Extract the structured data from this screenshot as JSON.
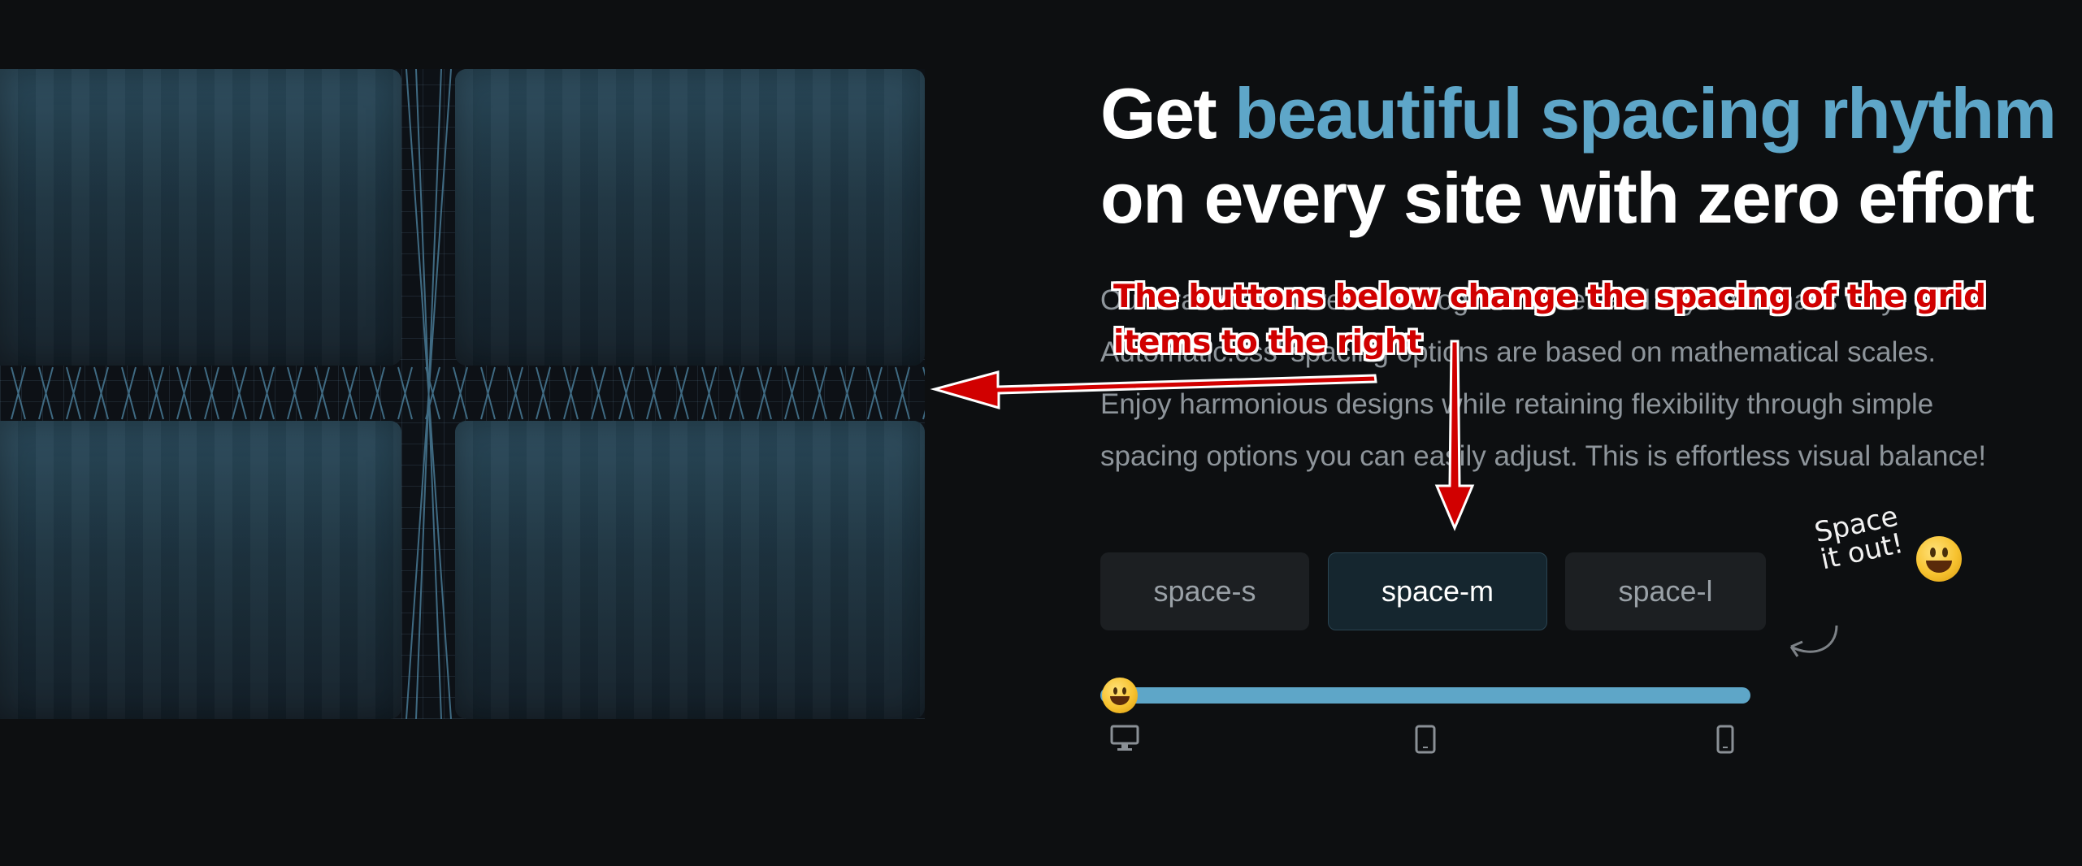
{
  "headline": {
    "prefix": "Get ",
    "highlight": "beautiful spacing rhythm",
    "line2": "on every site with zero effort"
  },
  "description": {
    "lines": [
      "Our brains are wired to recognize order and rhythm. That's why",
      "Automatic.css' spacing options are based on mathematical scales.",
      "Enjoy harmonious designs while retaining flexibility through simple",
      "spacing options you can easily adjust. This is effortless visual balance!"
    ]
  },
  "spacing_buttons": [
    {
      "label": "space-s",
      "active": false
    },
    {
      "label": "space-m",
      "active": true
    },
    {
      "label": "space-l",
      "active": false
    }
  ],
  "callout": {
    "line1": "Space",
    "line2": "it out!"
  },
  "slider": {
    "value": 0,
    "devices": [
      "desktop-icon",
      "tablet-icon",
      "mobile-icon"
    ]
  },
  "annotation": {
    "line1": "The buttons below change the spacing of the grid",
    "line2": "items to the right"
  },
  "colors": {
    "background": "#0d0f11",
    "accent": "#5ea6c8",
    "annotation": "#d10000",
    "active_button": "#15262f"
  }
}
